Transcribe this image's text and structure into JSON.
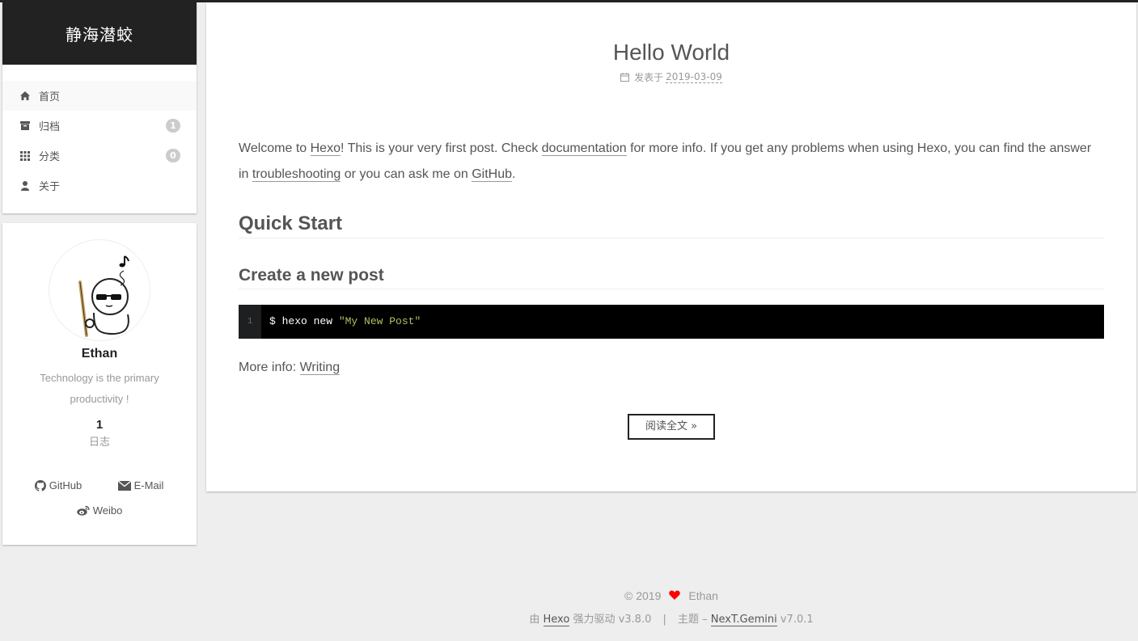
{
  "site": {
    "brand": "静海潜蛟"
  },
  "menu": [
    {
      "label": "首页",
      "icon": "home-icon",
      "badge": ""
    },
    {
      "label": "归档",
      "icon": "archive-icon",
      "badge": "1"
    },
    {
      "label": "分类",
      "icon": "grid-icon",
      "badge": "0"
    },
    {
      "label": "关于",
      "icon": "user-icon",
      "badge": ""
    }
  ],
  "profile": {
    "name": "Ethan",
    "description": "Technology is the primary productivity !",
    "posts_count": "1",
    "posts_label": "日志",
    "social": [
      {
        "label": "GitHub",
        "icon": "github-icon"
      },
      {
        "label": "E-Mail",
        "icon": "envelope-icon"
      },
      {
        "label": "Weibo",
        "icon": "weibo-icon"
      }
    ]
  },
  "post": {
    "title": "Hello World",
    "meta_label": "发表于",
    "date": "2019-03-09",
    "intro": {
      "p1": "Welcome to ",
      "hexo": "Hexo",
      "p2": "! This is your very first post. Check ",
      "documentation": "documentation",
      "p3": " for more info. If you get any problems when using Hexo, you can find the answer in ",
      "troubleshooting": "troubleshooting",
      "p4": " or you can ask me on ",
      "github": "GitHub",
      "p5": "."
    },
    "h_quick_start": "Quick Start",
    "h_create_post": "Create a new post",
    "code": {
      "line_no": "1",
      "cmd": "$ hexo new ",
      "arg": "\"My New Post\""
    },
    "more_info_label": "More info: ",
    "more_info_link": "Writing",
    "read_more": "阅读全文 »"
  },
  "footer": {
    "copyright": "© 2019",
    "author": "Ethan",
    "powered_prefix": "由",
    "hexo_link": "Hexo",
    "powered_suffix": "强力驱动 v3.8.0",
    "separator": "|",
    "theme_prefix": "主题 –",
    "theme_link": "NexT.Gemini",
    "theme_version": "v7.0.1"
  },
  "colors": {
    "brand_bg": "#222222",
    "page_bg": "#eeeeee",
    "heart": "#ff0000",
    "code_bg": "#000000",
    "code_string": "#b5bd68"
  }
}
